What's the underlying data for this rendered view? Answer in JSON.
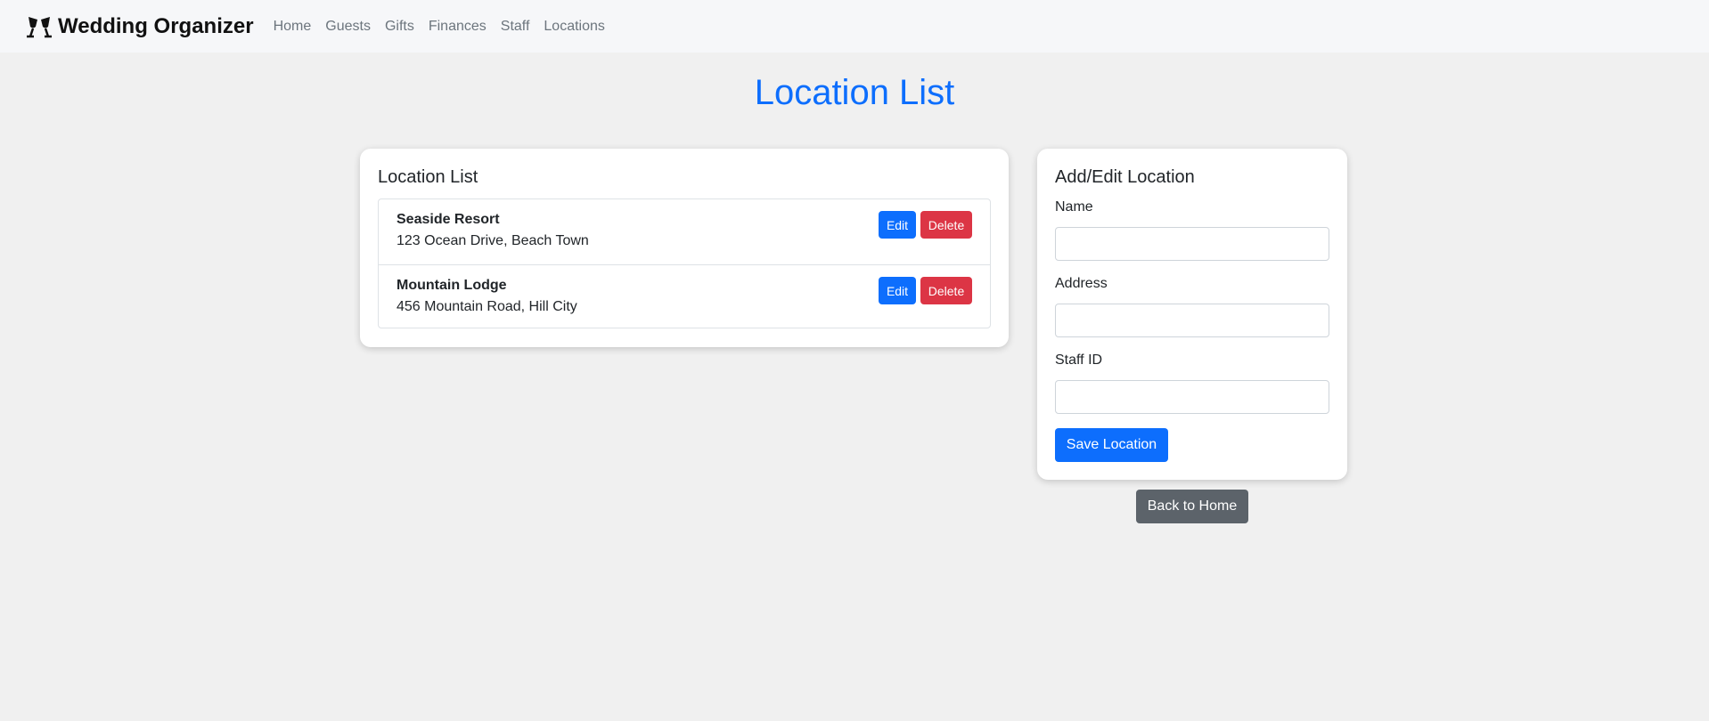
{
  "nav": {
    "brand_icon": "clinking-glasses-icon",
    "brand_label": "Wedding Organizer",
    "links": [
      {
        "label": "Home"
      },
      {
        "label": "Guests"
      },
      {
        "label": "Gifts"
      },
      {
        "label": "Finances"
      },
      {
        "label": "Staff"
      },
      {
        "label": "Locations"
      }
    ]
  },
  "page": {
    "title": "Location List"
  },
  "location_list": {
    "title": "Location List",
    "items": [
      {
        "name": "Seaside Resort",
        "address": "123 Ocean Drive, Beach Town",
        "edit_label": "Edit",
        "delete_label": "Delete"
      },
      {
        "name": "Mountain Lodge",
        "address": "456 Mountain Road, Hill City",
        "edit_label": "Edit",
        "delete_label": "Delete"
      }
    ]
  },
  "form": {
    "title": "Add/Edit Location",
    "fields": [
      {
        "label": "Name",
        "value": "",
        "placeholder": ""
      },
      {
        "label": "Address",
        "value": "",
        "placeholder": ""
      },
      {
        "label": "Staff ID",
        "value": "",
        "placeholder": ""
      }
    ],
    "save_label": "Save Location"
  },
  "back_label": "Back to Home",
  "colors": {
    "primary": "#0d6efd",
    "danger": "#dc3545",
    "secondary": "#5c636a",
    "background": "#f0f0f0",
    "navbar": "#f6f7f9"
  }
}
